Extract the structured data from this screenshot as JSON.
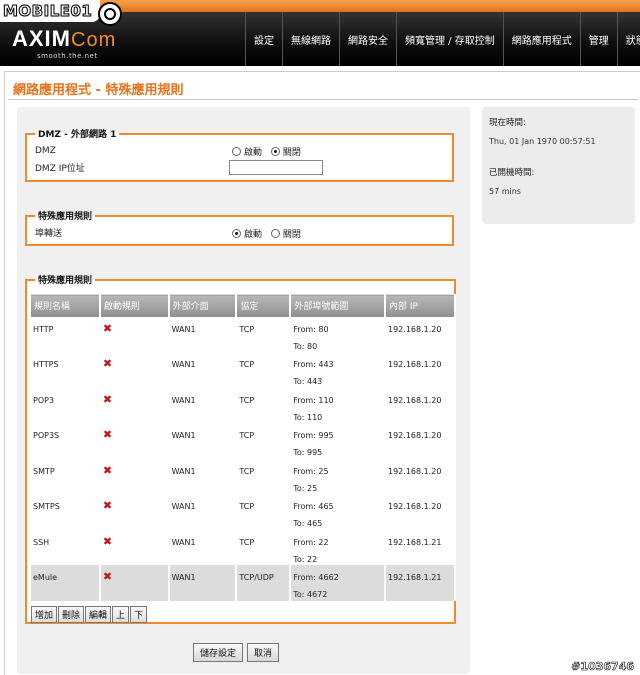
{
  "header": {
    "watermark_brand": "MOBILE01",
    "logo_main": "AXIM",
    "logo_suffix": "Com",
    "tagline": "smooth.the.net",
    "nav": [
      "設定",
      "無線網路",
      "網路安全",
      "頻寬管理 / 存取控制",
      "網路應用程式",
      "管理",
      "狀態"
    ]
  },
  "page": {
    "title": "網路應用程式 - 特殊應用規則"
  },
  "dmz": {
    "legend": "DMZ - 外部網路 1",
    "dmz_label": "DMZ",
    "dmz_options": [
      "啟動",
      "關閉"
    ],
    "dmz_selected": "關閉",
    "ip_label": "DMZ IP位址",
    "ip_value": ""
  },
  "special_rules_toggle": {
    "legend": "特殊應用規則",
    "label": "埠轉送",
    "options": [
      "啟動",
      "關閉"
    ],
    "selected": "啟動"
  },
  "rules": {
    "legend": "特殊應用規則",
    "columns": [
      "規則名稱",
      "啟動規則",
      "外部介面",
      "協定",
      "外部埠號範圍",
      "內部 IP"
    ],
    "rows": [
      {
        "name": "HTTP",
        "iface": "WAN1",
        "proto": "TCP",
        "from": "From: 80",
        "to": "To: 80",
        "ip": "192.168.1.20"
      },
      {
        "name": "HTTPS",
        "iface": "WAN1",
        "proto": "TCP",
        "from": "From: 443",
        "to": "To: 443",
        "ip": "192.168.1.20"
      },
      {
        "name": "POP3",
        "iface": "WAN1",
        "proto": "TCP",
        "from": "From: 110",
        "to": "To: 110",
        "ip": "192.168.1.20"
      },
      {
        "name": "POP3S",
        "iface": "WAN1",
        "proto": "TCP",
        "from": "From: 995",
        "to": "To: 995",
        "ip": "192.168.1.20"
      },
      {
        "name": "SMTP",
        "iface": "WAN1",
        "proto": "TCP",
        "from": "From: 25",
        "to": "To: 25",
        "ip": "192.168.1.20"
      },
      {
        "name": "SMTPS",
        "iface": "WAN1",
        "proto": "TCP",
        "from": "From: 465",
        "to": "To: 465",
        "ip": "192.168.1.20"
      },
      {
        "name": "SSH",
        "iface": "WAN1",
        "proto": "TCP",
        "from": "From: 22",
        "to": "To: 22",
        "ip": "192.168.1.21"
      },
      {
        "name": "eMule",
        "iface": "WAN1",
        "proto": "TCP/UDP",
        "from": "From: 4662",
        "to": "To: 4672",
        "ip": "192.168.1.21"
      }
    ],
    "buttons": [
      "增加",
      "刪除",
      "編輯",
      "上",
      "下"
    ]
  },
  "footer_buttons": {
    "save": "儲存設定",
    "cancel": "取消"
  },
  "status": {
    "time_label": "現在時間:",
    "time_value": "Thu, 01 Jan 1970 00:57:51",
    "uptime_label": "已開機時間:",
    "uptime_value": "57 mins"
  },
  "image_watermark": "#1036746",
  "colors": {
    "accent": "#e8731c",
    "header_bg": "#1a1a1a",
    "disabled_icon": "#d01010"
  }
}
